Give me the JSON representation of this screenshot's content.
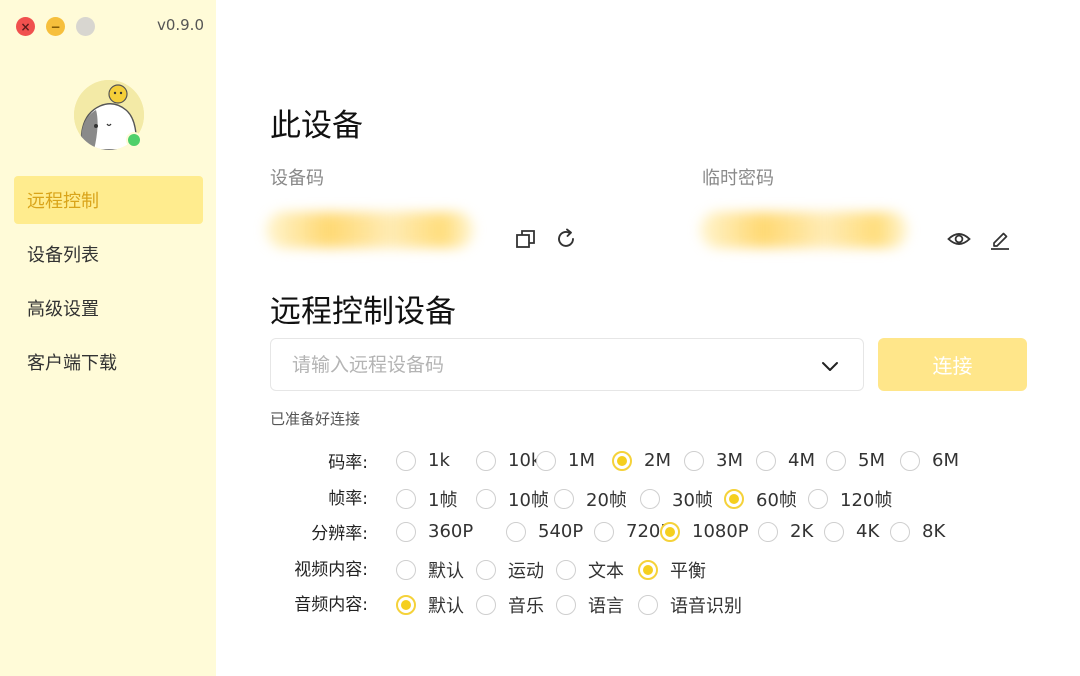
{
  "window": {
    "close_glyph": "×",
    "minimize_glyph": "−",
    "version": "v0.9.0"
  },
  "sidebar": {
    "items": [
      {
        "label": "远程控制",
        "active": true
      },
      {
        "label": "设备列表",
        "active": false
      },
      {
        "label": "高级设置",
        "active": false
      },
      {
        "label": "客户端下载",
        "active": false
      }
    ]
  },
  "this_device": {
    "title": "此设备",
    "device_code_label": "设备码",
    "temp_password_label": "临时密码",
    "icons": [
      "copy-icon",
      "refresh-icon",
      "eye-icon",
      "edit-icon"
    ]
  },
  "remote": {
    "title": "远程控制设备",
    "input_placeholder": "请输入远程设备码",
    "input_value": "",
    "connect_label": "连接",
    "status": "已准备好连接"
  },
  "settings": [
    {
      "label": "码率:",
      "options": [
        "1k",
        "10k",
        "1M",
        "2M",
        "3M",
        "4M",
        "5M",
        "6M"
      ],
      "selected": "2M"
    },
    {
      "label": "帧率:",
      "options": [
        "1帧",
        "10帧",
        "20帧",
        "30帧",
        "60帧",
        "120帧"
      ],
      "selected": "60帧"
    },
    {
      "label": "分辨率:",
      "options": [
        "360P",
        "540P",
        "720P",
        "1080P",
        "2K",
        "4K",
        "8K"
      ],
      "selected": "1080P"
    },
    {
      "label": "视频内容:",
      "options": [
        "默认",
        "运动",
        "文本",
        "平衡"
      ],
      "selected": "平衡"
    },
    {
      "label": "音频内容:",
      "options": [
        "默认",
        "音乐",
        "语言",
        "语音识别"
      ],
      "selected": "默认"
    }
  ],
  "colors": {
    "sidebar_bg": "#fffbd8",
    "accent": "#f5cf1e",
    "active_nav_bg": "#ffec8e",
    "connect_button": "#ffe68a"
  }
}
